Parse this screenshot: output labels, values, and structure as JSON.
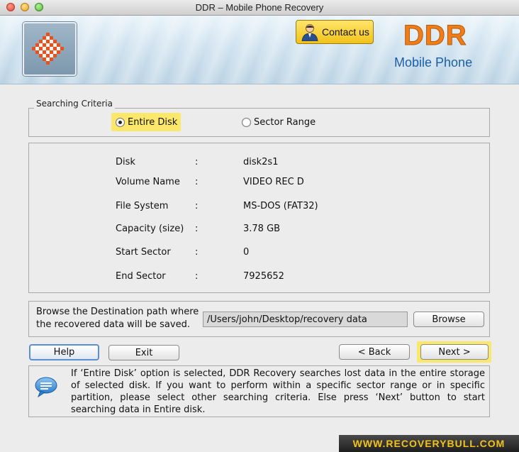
{
  "window": {
    "title": "DDR – Mobile Phone Recovery"
  },
  "header": {
    "contact_label": "Contact us",
    "brand": "DDR",
    "brand_sub": "Mobile Phone",
    "brand_color": "#f07d18",
    "sub_color": "#1b5fa8"
  },
  "criteria": {
    "legend": "Searching Criteria",
    "options": [
      {
        "label": "Entire Disk",
        "selected": true
      },
      {
        "label": "Sector Range",
        "selected": false
      }
    ]
  },
  "disk_info": {
    "rows": [
      {
        "label": "Disk",
        "value": "disk2s1"
      },
      {
        "label": "Volume Name",
        "value": "VIDEO REC D"
      },
      {
        "label": "File System",
        "value": "MS-DOS (FAT32)"
      },
      {
        "label": "Capacity (size)",
        "value": "3.78  GB"
      },
      {
        "label": "Start Sector",
        "value": "0"
      },
      {
        "label": "End Sector",
        "value": "7925652"
      }
    ],
    "separator": ":"
  },
  "destination": {
    "prompt": "Browse the Destination path where the recovered data will be saved.",
    "path": "/Users/john/Desktop/recovery data",
    "browse_label": "Browse"
  },
  "buttons": {
    "help": "Help",
    "exit": "Exit",
    "back": "< Back",
    "next": "Next >"
  },
  "help_text": "If ‘Entire Disk’ option is selected, DDR Recovery searches lost data in the entire storage of selected disk. If you want to perform within a specific sector range or in specific partition, please select other searching criteria. Else press ‘Next’ button to start searching data in Entire disk.",
  "footer": "WWW.RECOVERYBULL.COM"
}
